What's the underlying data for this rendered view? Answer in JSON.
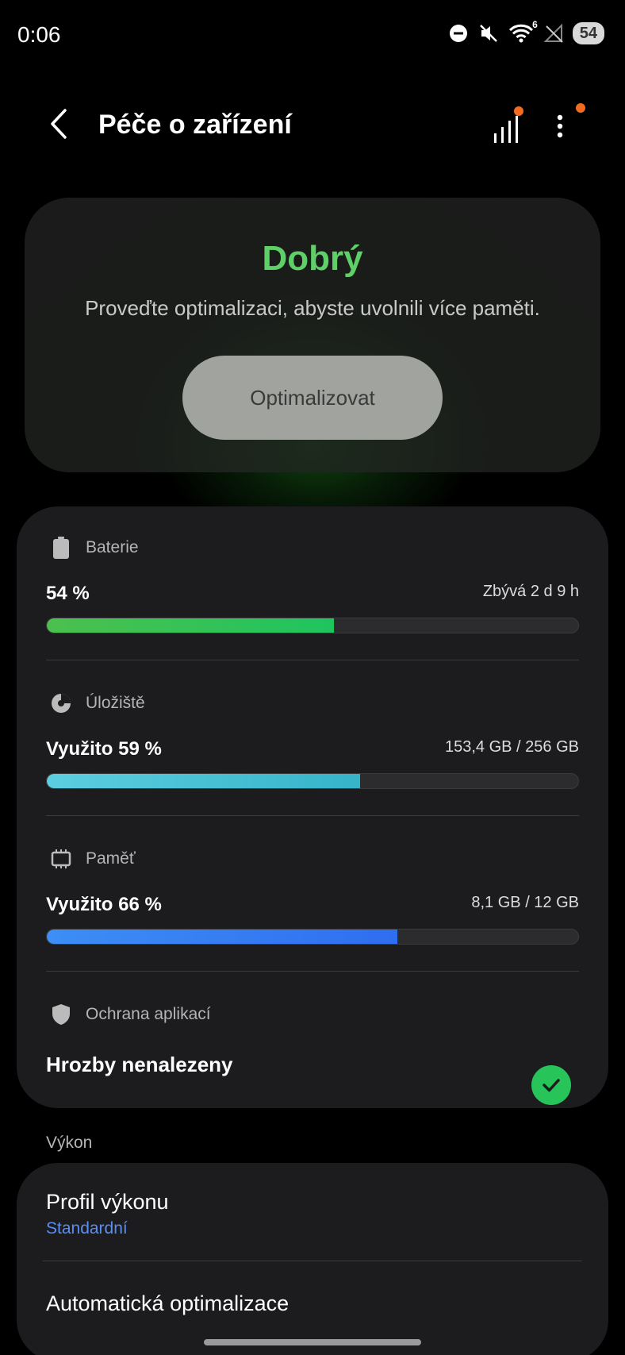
{
  "status_bar": {
    "time": "0:06",
    "battery_level": "54",
    "wifi_badge": "6",
    "icons": [
      "do-not-disturb-icon",
      "mute-icon",
      "wifi-icon",
      "no-signal-icon",
      "battery-icon"
    ]
  },
  "header": {
    "title": "Péče o zařízení",
    "has_stats_badge": true,
    "has_menu_badge": true,
    "badge_color": "#f26b21"
  },
  "status_card": {
    "status": "Dobrý",
    "status_color": "#5fd068",
    "description": "Proveďte optimalizaci, abyste uvolnili více paměti.",
    "button_label": "Optimalizovat"
  },
  "summary": {
    "battery": {
      "label": "Baterie",
      "value": "54 %",
      "side": "Zbývá 2 d 9 h",
      "fraction": 0.54,
      "colors": [
        "#4cc04e",
        "#1fc45f"
      ]
    },
    "storage": {
      "label": "Úložiště",
      "value": "Využito 59 %",
      "side": "153,4 GB / 256 GB",
      "fraction": 0.59,
      "colors": [
        "#5ccfe0",
        "#36b3c9"
      ]
    },
    "memory": {
      "label": "Paměť",
      "value": "Využito 66 %",
      "side": "8,1 GB / 12 GB",
      "fraction": 0.66,
      "colors": [
        "#3d8ef5",
        "#2f6ef0"
      ]
    },
    "app_protection": {
      "label": "Ochrana aplikací",
      "value": "Hrozby nenalezeny",
      "status_icon": "check-icon",
      "status_color": "#27c45a"
    }
  },
  "performance": {
    "section_label": "Výkon",
    "items": [
      {
        "title": "Profil výkonu",
        "subtitle": "Standardní"
      },
      {
        "title": "Automatická optimalizace"
      }
    ]
  }
}
